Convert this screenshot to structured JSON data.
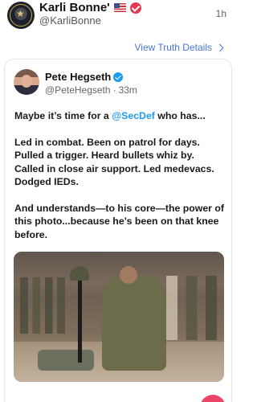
{
  "post": {
    "display_name": "Karli Bonne'",
    "handle": "@KarliBonne",
    "time": "1h",
    "view_link": "View Truth Details"
  },
  "quoted": {
    "name": "Pete Hegseth",
    "handle": "@PeteHegseth",
    "time": "33m",
    "paragraphs": [
      {
        "pre": "Maybe it’s time for a ",
        "mention": "@SecDef",
        "post": " who has..."
      },
      {
        "pre": "Led in combat. Been on patrol for days. Pulled a trigger. Heard bullets whiz by. Called in close air support. Led medevacs. Dodged IEDs.",
        "mention": "",
        "post": ""
      },
      {
        "pre": "And understands—to his core—the power of this photo...because he’s been on that knee before.",
        "mention": "",
        "post": ""
      }
    ]
  },
  "colors": {
    "link": "#4a76d6",
    "mention": "#1d9bf0",
    "verified_red": "#e3384f",
    "verified_blue": "#1d9bf0",
    "fab": "#ec4266"
  },
  "icons": {
    "flag": "us-flag-icon",
    "verified_post": "verified-badge-icon",
    "verified_quoted": "verified-badge-icon",
    "chevron": "chevron-right-icon"
  }
}
